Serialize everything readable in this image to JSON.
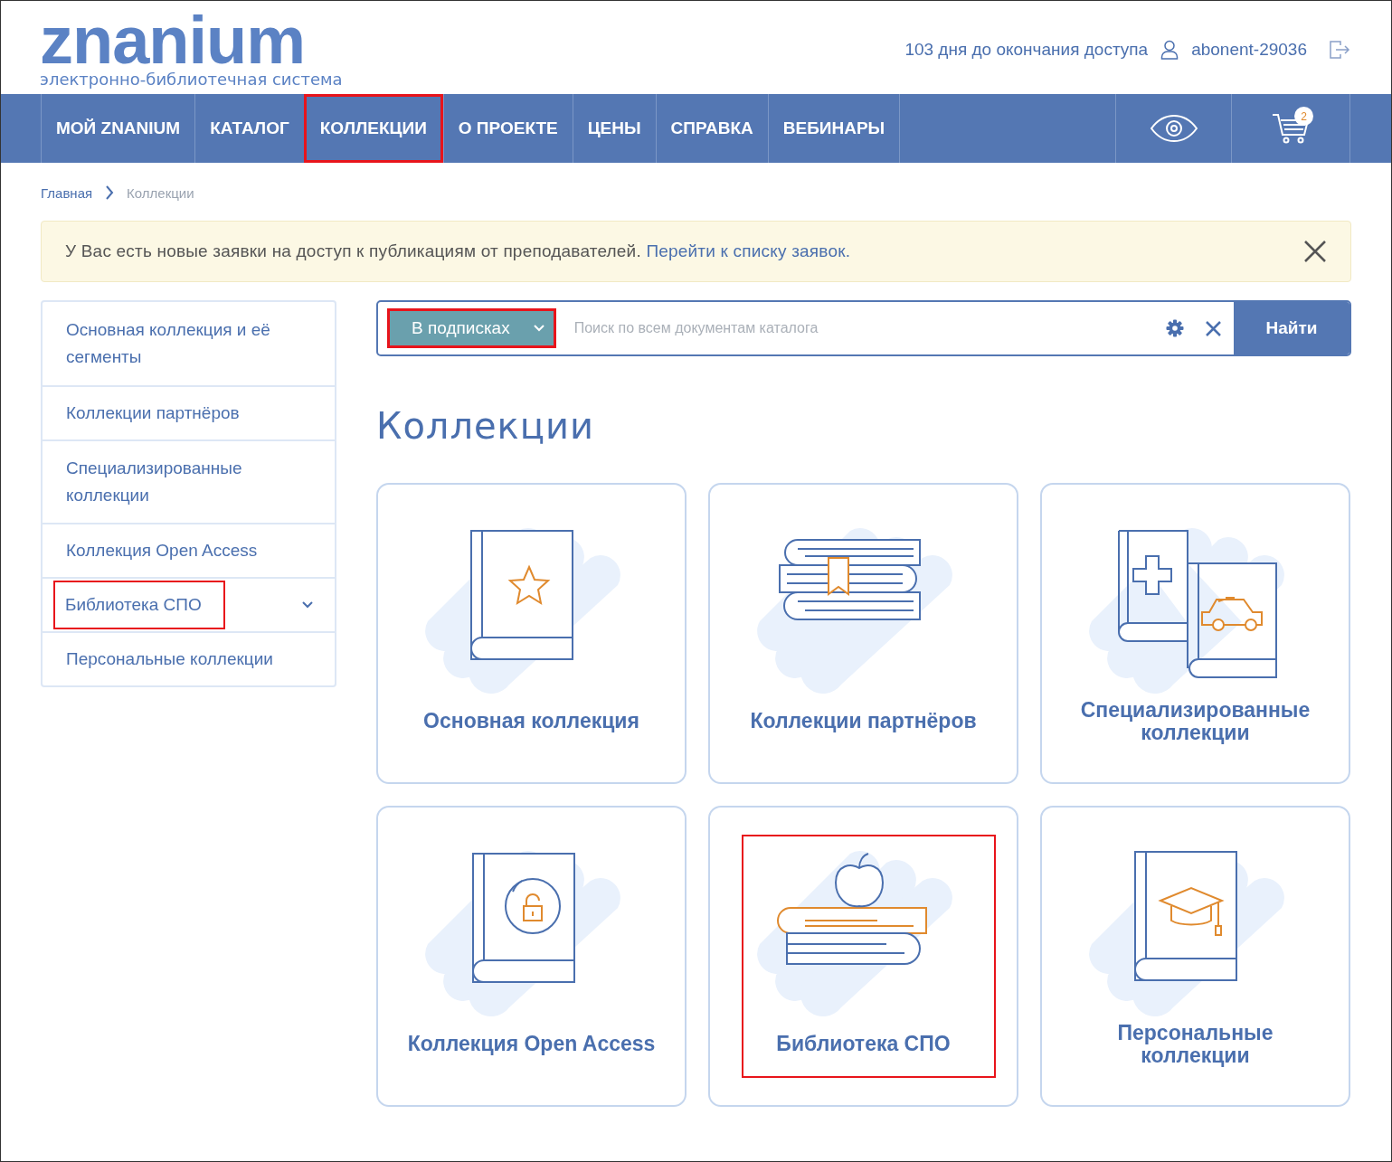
{
  "header": {
    "logo": "znanium",
    "tagline": "электронно-библиотечная система",
    "access_days": "103 дня до окончания доступа",
    "user": "abonent-29036"
  },
  "nav": {
    "items": [
      {
        "label": "МОЙ ZNANIUM",
        "highlighted": false
      },
      {
        "label": "КАТАЛОГ",
        "highlighted": false
      },
      {
        "label": "КОЛЛЕКЦИИ",
        "highlighted": true
      },
      {
        "label": "О ПРОЕКТЕ",
        "highlighted": false
      },
      {
        "label": "ЦЕНЫ",
        "highlighted": false
      },
      {
        "label": "СПРАВКА",
        "highlighted": false
      },
      {
        "label": "ВЕБИНАРЫ",
        "highlighted": false
      }
    ],
    "cart_count": "2"
  },
  "breadcrumbs": [
    "Главная",
    "Коллекции"
  ],
  "alert": {
    "text": "У Вас есть новые заявки на доступ к публикациям от преподавателей.",
    "link": "Перейти к списку заявок."
  },
  "sidebar": {
    "items": [
      {
        "label": "Основная коллекция и её сегменты",
        "expandable": false,
        "highlighted": false
      },
      {
        "label": "Коллекции партнёров",
        "expandable": false,
        "highlighted": false
      },
      {
        "label": "Специализированные коллекции",
        "expandable": false,
        "highlighted": false
      },
      {
        "label": "Коллекция Open Access",
        "expandable": false,
        "highlighted": false
      },
      {
        "label": "Библиотека СПО",
        "expandable": true,
        "highlighted": true
      },
      {
        "label": "Персональные коллекции",
        "expandable": false,
        "highlighted": false
      }
    ]
  },
  "search": {
    "filter": "В подписках",
    "filter_highlighted": true,
    "placeholder": "Поиск по всем документам каталога",
    "button": "Найти"
  },
  "heading": "Коллекции",
  "cards": [
    {
      "title": "Основная коллекция",
      "kind": "star-book",
      "highlighted": false
    },
    {
      "title": "Коллекции партнёров",
      "kind": "book-stack",
      "highlighted": false
    },
    {
      "title": "Специализированные коллекции",
      "kind": "medical-car-books",
      "highlighted": false
    },
    {
      "title": "Коллекция Open Access",
      "kind": "lock-book",
      "highlighted": false
    },
    {
      "title": "Библиотека СПО",
      "kind": "apple-books",
      "highlighted": true
    },
    {
      "title": "Персональные коллекции",
      "kind": "cap-book",
      "highlighted": false
    }
  ]
}
